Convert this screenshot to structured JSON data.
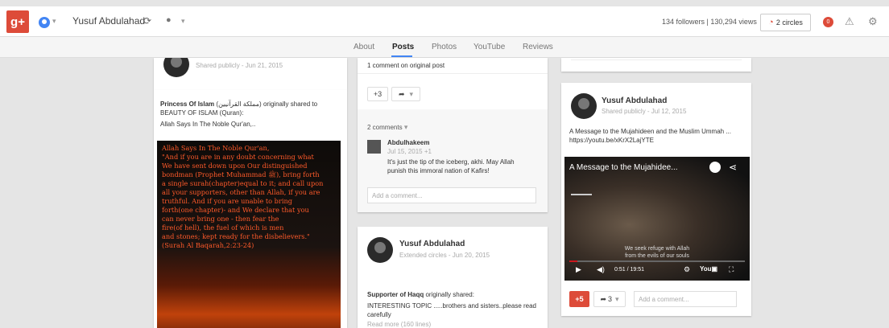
{
  "header": {
    "logo": "g+",
    "username": "Yusuf Abdulahad",
    "stats": "134 followers | 130,294 views",
    "circles_label": "2 circles",
    "notifications": "0"
  },
  "tabs": [
    "About",
    "Posts",
    "Photos",
    "YouTube",
    "Reviews"
  ],
  "col1": {
    "meta": "Shared publicly - Jun 21, 2015",
    "shared_by": "Princess Of Islam",
    "shared_arabic": "(مملكة القرآنيين)",
    "shared_rest": "originally shared to",
    "shared_to": "BEAUTY OF ISLAM (Quran):",
    "excerpt": "Allah Says In The Noble Qur'an,..",
    "quote": "Allah Says In The Noble Qur'an,\n   \"And if you are in any doubt concerning what\nWe have sent down upon Our distinguished\nbondman (Prophet Muhammad ﷺ), bring forth\na single surah(chapter)equal to it; and call upon\nall your supporters, other than Allah, if you are\ntruthful. And if you are unable to bring\nforth(one chapter)- and We declare that you\ncan never bring one - then fear the\nfire(of hell), the fuel of which is men\nand stones; kept ready for the disbelievers.\"\n        (Surah Al Baqarah,2:23-24)"
  },
  "col2": {
    "comment_count_text": "1 comment on original post",
    "plus_label": "+3",
    "comments_toggle": "2 comments",
    "commenter": "Abdulhakeem",
    "comment_meta": "Jul 15, 2015  +1",
    "comment_text": "It's just the tip of the iceberg, akhi. May Allah punish this immoral nation of Kafirs!",
    "comment_placeholder": "Add a comment...",
    "post2_name": "Yusuf Abdulahad",
    "post2_meta": "Extended circles - Jun 20, 2015",
    "post2_sharer": "Supporter of Haqq",
    "post2_shared": "originally shared:",
    "post2_text": "INTERESTING TOPIC .....brothers and sisters..please read carefully",
    "post2_more": "Read more (160 lines)"
  },
  "col3": {
    "name": "Yusuf Abdulahad",
    "meta": "Shared publicly - Jul 12, 2015",
    "text": "A Message to the Mujahideen and the Muslim Ummah ... https://youtu.be/xKrX2LajYTE",
    "video_title": "A Message to the Mujahidee...",
    "video_sub": "We seek refuge with Allah\nfrom the evils of our souls",
    "video_time": "0:51 / 19:51",
    "video_progress": 0.045,
    "plus_label": "+5",
    "share_label": "3",
    "comment_placeholder": "Add a comment..."
  }
}
